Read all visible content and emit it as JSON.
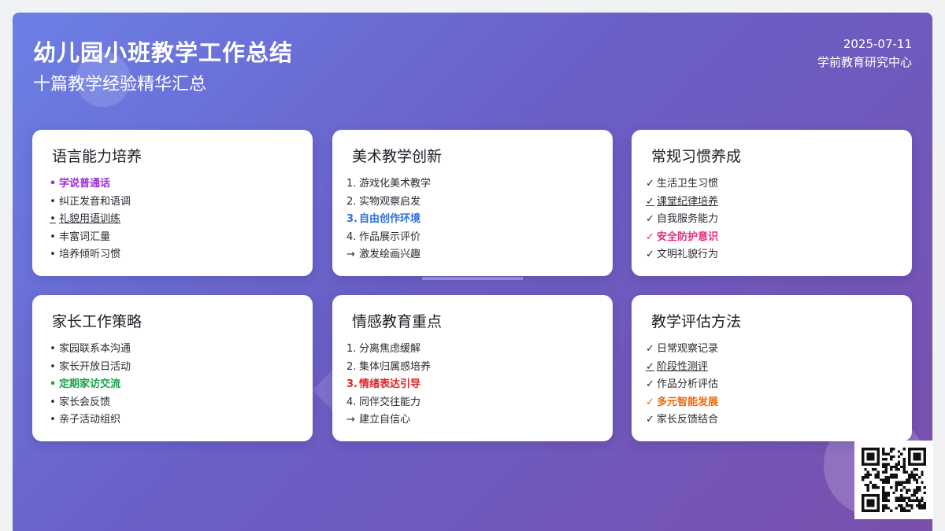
{
  "header": {
    "title": "幼儿园小班教学工作总结",
    "subtitle": "十篇教学经验精华汇总",
    "date": "2025-07-11",
    "org": "学前教育研究中心"
  },
  "colors": {
    "purple": "#9b30d9",
    "blue": "#2f6fe0",
    "pink": "#e0307c",
    "green": "#16a34a",
    "red": "#dc2626",
    "orange": "#ea6a0c"
  },
  "cards": [
    {
      "title": "语言能力培养",
      "items": [
        {
          "marker": "•",
          "text": "学说普通话",
          "highlight": "purple"
        },
        {
          "marker": "•",
          "text": "纠正发音和语调"
        },
        {
          "marker": "•",
          "text": "礼貌用语训练",
          "underline": true
        },
        {
          "marker": "•",
          "text": "丰富词汇量"
        },
        {
          "marker": "•",
          "text": "培养倾听习惯"
        }
      ]
    },
    {
      "title": "美术教学创新",
      "items": [
        {
          "marker": "1.",
          "text": "游戏化美术教学"
        },
        {
          "marker": "2.",
          "text": "实物观察启发"
        },
        {
          "marker": "3.",
          "text": "自由创作环境",
          "highlight": "blue"
        },
        {
          "marker": "4.",
          "text": "作品展示评价"
        },
        {
          "marker": "→",
          "text": "激发绘画兴趣"
        }
      ]
    },
    {
      "title": "常规习惯养成",
      "items": [
        {
          "marker": "✓",
          "text": "生活卫生习惯"
        },
        {
          "marker": "✓",
          "text": "课堂纪律培养",
          "underline": true
        },
        {
          "marker": "✓",
          "text": "自我服务能力"
        },
        {
          "marker": "✓",
          "text": "安全防护意识",
          "highlight": "pink"
        },
        {
          "marker": "✓",
          "text": "文明礼貌行为"
        }
      ]
    },
    {
      "title": "家长工作策略",
      "items": [
        {
          "marker": "•",
          "text": "家园联系本沟通"
        },
        {
          "marker": "•",
          "text": "家长开放日活动"
        },
        {
          "marker": "•",
          "text": "定期家访交流",
          "highlight": "green"
        },
        {
          "marker": "•",
          "text": "家长会反馈"
        },
        {
          "marker": "•",
          "text": "亲子活动组织"
        }
      ]
    },
    {
      "title": "情感教育重点",
      "items": [
        {
          "marker": "1.",
          "text": "分离焦虑缓解"
        },
        {
          "marker": "2.",
          "text": "集体归属感培养"
        },
        {
          "marker": "3.",
          "text": "情绪表达引导",
          "highlight": "red"
        },
        {
          "marker": "4.",
          "text": "同伴交往能力"
        },
        {
          "marker": "→",
          "text": "建立自信心"
        }
      ]
    },
    {
      "title": "教学评估方法",
      "items": [
        {
          "marker": "✓",
          "text": "日常观察记录"
        },
        {
          "marker": "✓",
          "text": "阶段性测评",
          "underline": true
        },
        {
          "marker": "✓",
          "text": "作品分析评估"
        },
        {
          "marker": "✓",
          "text": "多元智能发展",
          "highlight": "orange"
        },
        {
          "marker": "✓",
          "text": "家长反馈结合"
        }
      ]
    }
  ]
}
